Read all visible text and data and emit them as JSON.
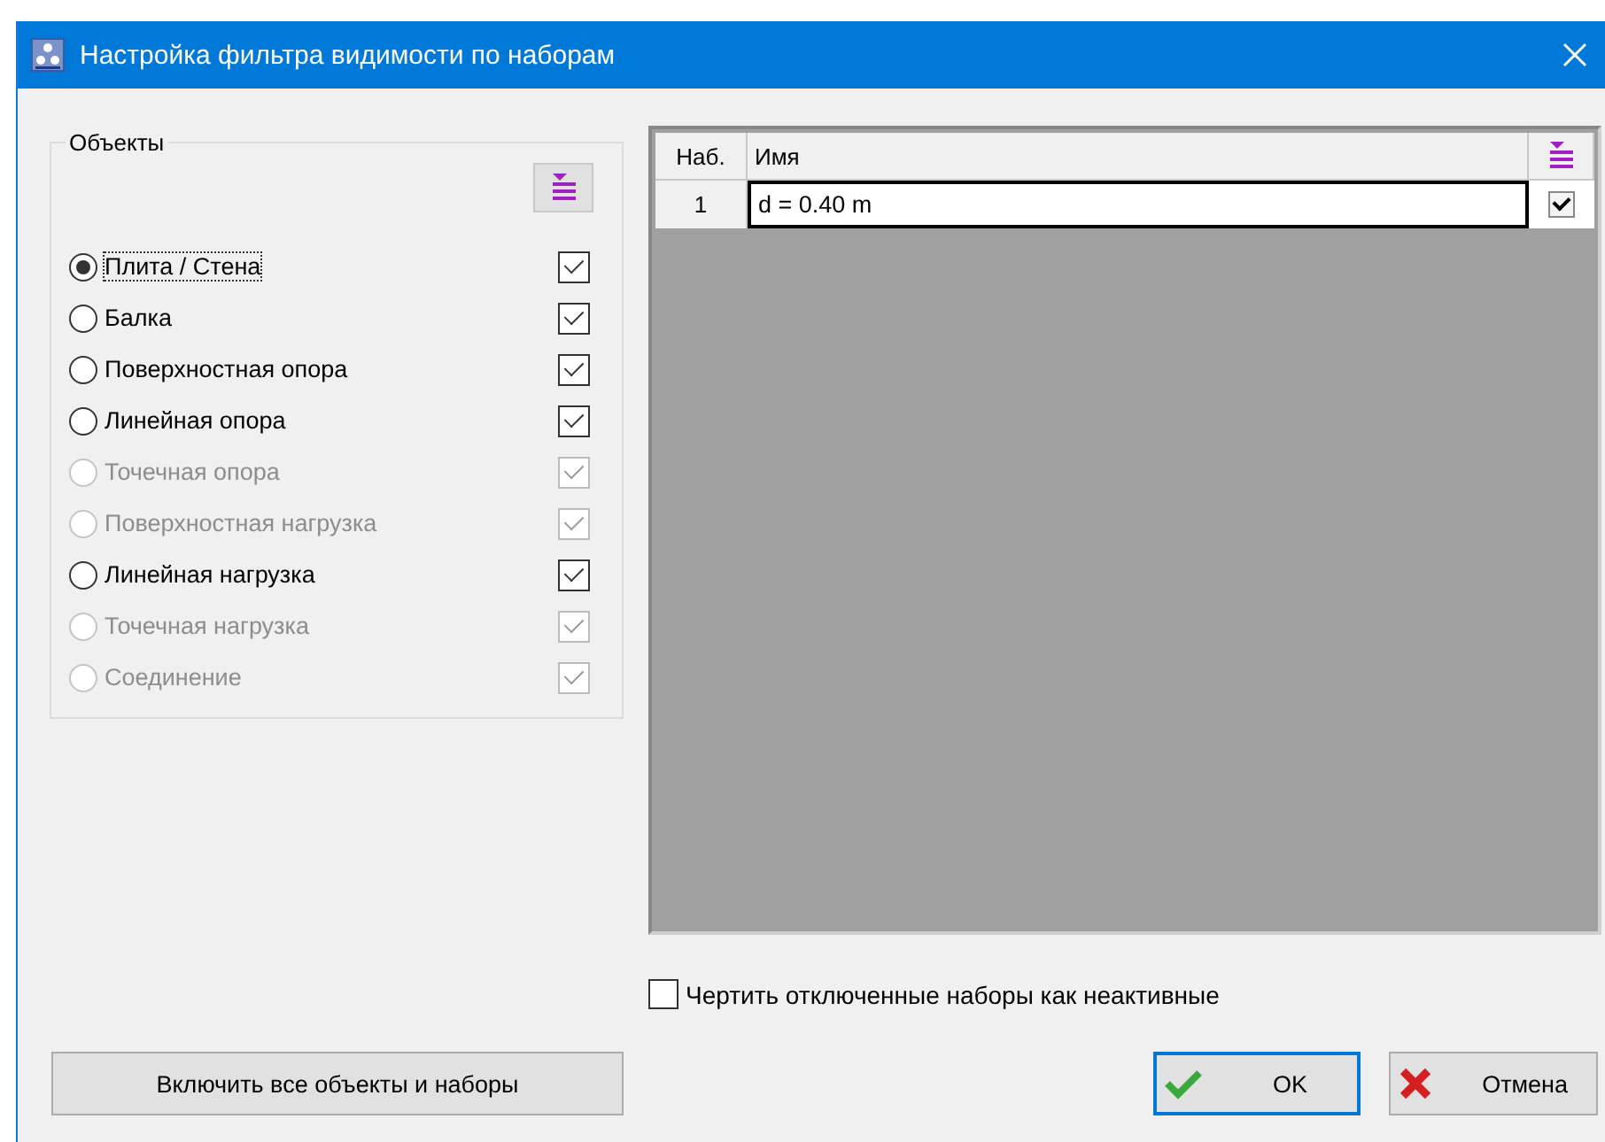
{
  "window": {
    "title": "Настройка фильтра видимости по наборам"
  },
  "objects": {
    "title": "Объекты",
    "items": [
      {
        "label": "Плита / Стена",
        "selected": true,
        "disabled": false,
        "checked": true
      },
      {
        "label": "Балка",
        "selected": false,
        "disabled": false,
        "checked": true
      },
      {
        "label": "Поверхностная опора",
        "selected": false,
        "disabled": false,
        "checked": true
      },
      {
        "label": "Линейная опора",
        "selected": false,
        "disabled": false,
        "checked": true
      },
      {
        "label": "Точечная опора",
        "selected": false,
        "disabled": true,
        "checked": true
      },
      {
        "label": "Поверхностная нагрузка",
        "selected": false,
        "disabled": true,
        "checked": true
      },
      {
        "label": "Линейная нагрузка",
        "selected": false,
        "disabled": false,
        "checked": true
      },
      {
        "label": "Точечная нагрузка",
        "selected": false,
        "disabled": true,
        "checked": true
      },
      {
        "label": "Соединение",
        "selected": false,
        "disabled": true,
        "checked": true
      }
    ]
  },
  "sets_table": {
    "columns": [
      "Наб.",
      "Имя"
    ],
    "rows": [
      {
        "number": "1",
        "name": "d = 0.40 m",
        "checked": true
      }
    ]
  },
  "draw_disabled_inactive": {
    "label": "Чертить отключенные наборы как неактивные",
    "checked": false
  },
  "buttons": {
    "enable_all": "Включить все объекты и наборы",
    "ok": "OK",
    "cancel": "Отмена"
  }
}
